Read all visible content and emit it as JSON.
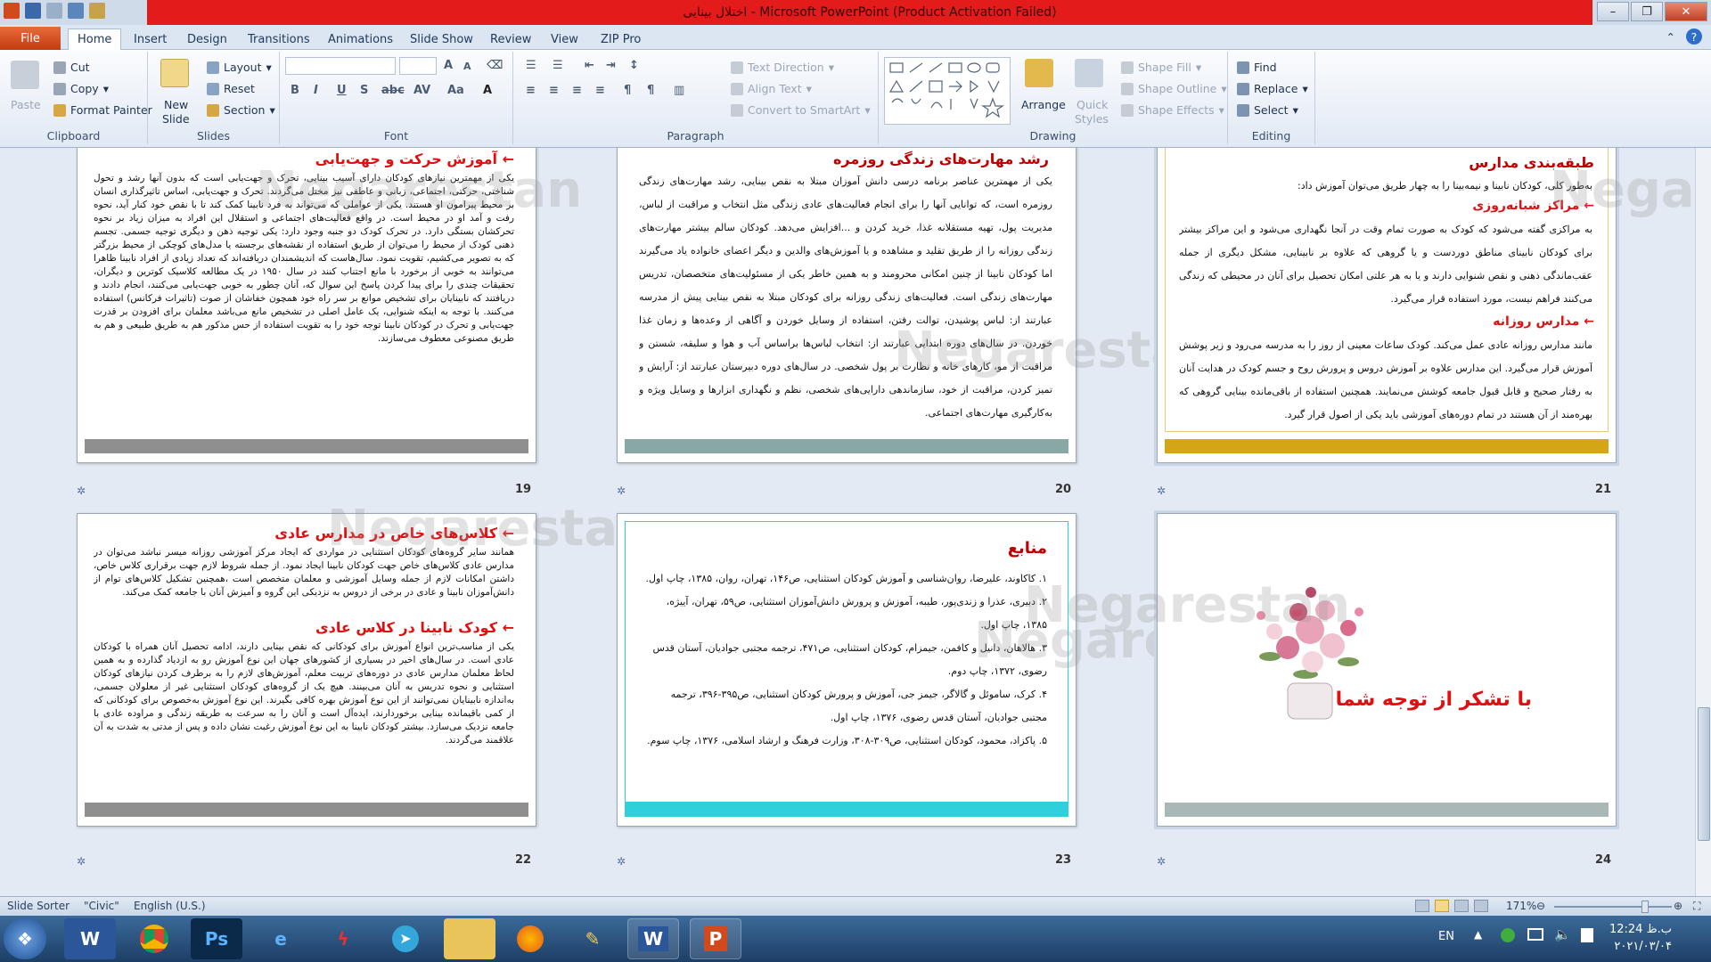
{
  "window": {
    "title": "اختلال بینایی  - Microsoft PowerPoint (Product Activation Failed)",
    "minimize_icon": "minimize-icon",
    "maximize_icon": "restore-icon",
    "close_icon": "close-icon"
  },
  "tabs": [
    "File",
    "Home",
    "Insert",
    "Design",
    "Transitions",
    "Animations",
    "Slide Show",
    "Review",
    "View",
    "ZIP Pro"
  ],
  "ribbon": {
    "clipboard": {
      "label": "Clipboard",
      "paste": "Paste",
      "cut": "Cut",
      "copy": "Copy",
      "format_painter": "Format Painter"
    },
    "slides": {
      "label": "Slides",
      "new_slide": "New",
      "new_slide2": "Slide",
      "layout": "Layout",
      "reset": "Reset",
      "section": "Section"
    },
    "font": {
      "label": "Font"
    },
    "paragraph": {
      "label": "Paragraph",
      "text_direction": "Text Direction",
      "align_text": "Align Text",
      "convert": "Convert to SmartArt"
    },
    "drawing": {
      "label": "Drawing",
      "arrange": "Arrange",
      "quick_styles": "Quick",
      "quick_styles2": "Styles",
      "shape_fill": "Shape Fill",
      "shape_outline": "Shape Outline",
      "shape_effects": "Shape Effects"
    },
    "editing": {
      "label": "Editing",
      "find": "Find",
      "replace": "Replace",
      "select": "Select"
    }
  },
  "watermark": "Negarestan",
  "slides": [
    {
      "number": "19",
      "title": "آموزش حرکت و جهت‌یابی",
      "body": "یکی از مهمترین نیازهای کودکان دارای آسیب بینایی، تحرک و جهت‌یابی است که بدون آنها رشد و تحول شناختی، حرکتی، اجتماعی، زبانی و عاطفی نیز مختل می‌گردند. تحرک و جهت‌یابی، اساس تاثیرگذاری انسان بر محیط پیرامون او هستند. یکی از عواملی که می‌تواند به فرد نابینا کمک کند تا با نقص خود کنار آید، نحوه رفت و آمد او در محیط است. در واقع فعالیت‌های اجتماعی و استقلال این افراد به میزان زیاد بر نحوه تحرکشان بستگی دارد. در تحرک کودک دو جنبه وجود دارد: یکی توجیه ذهن و دیگری توجیه جسمی. تجسم ذهنی کودک از محیط را می‌توان از طریق استفاده از نقشه‌های برجسته یا مدل‌های کوچکی از محیط بزرگتر که به تصویر می‌کشیم، تقویت نمود. سال‌هاست که اندیشمندان دریافته‌اند که تعداد زیادی از افراد نابینا ظاهرا می‌توانند به خوبی از برخورد با مانع اجتناب کنند در سال ۱۹۵۰ در یک مطالعه کلاسیک کوترین و دیگران، تحقیقات چندی را برای پیدا کردن پاسخ این سوال که، آنان چطور به خوبی جهت‌یابی می‌کنند، انجام دادند و دریافتند که نابینایان برای تشخیص موانع بر سر راه خود همچون خفاشان از صوت (تاثیرات فرکانس) استفاده می‌کنند. با توجه به اینکه شنوایی، یک عامل اصلی در تشخیص مانع می‌باشد معلمان برای افزودن بر قدرت جهت‌یابی و تحرک در کودکان نابینا توجه خود را به تقویت استفاده از حس مذکور هم به طریق طبیعی و هم به طریق مصنوعی معطوف می‌سازند."
    },
    {
      "number": "20",
      "title": "رشد مهارت‌های زندگی روزمره",
      "body": "یکی از مهمترین عناصر برنامه درسی دانش آموزان مبتلا به نقص بینایی، رشد مهارت‌های زندگی روزمره است، که توانایی آنها را برای انجام فعالیت‌های عادی زندگی مثل انتخاب و مراقبت از لباس، مدیریت پول، تهیه مستقلانه غذا، خرید کردن و ...افزایش می‌دهد. کودکان سالم بیشتر مهارت‌های زندگی روزانه را از طریق تقلید و مشاهده و یا آموزش‌های والدین و دیگر اعضای خانواده یاد می‌گیرند اما کودکان نابینا از چنین امکانی محرومند و به همین خاطر یکی از مسئولیت‌های متخصصان، تدریس مهارت‌های زندگی است. فعالیت‌های زندگی روزانه برای کودکان مبتلا به نقص بینایی پیش از مدرسه عبارتند از: لباس پوشیدن، توالت رفتن، استفاده از وسایل خوردن و آگاهی از وعده‌ها و زمان غذا خوردن. در سال‌های دوره ابتدایی عبارتند از: انتخاب لباس‌ها براساس آب و هوا و سلیقه، شستن و مراقبت از مو، کارهای خانه و نظارت بر پول شخصی. در سال‌های دوره دبیرستان عبارتند از: آرایش و تمیز کردن، مراقبت از خود، سازماندهی دارایی‌های شخصی، نظم و نگهداری ابزارها و وسایل ویژه و به‌کارگیری مهارت‌های اجتماعی."
    },
    {
      "number": "21",
      "title": "طبقه‌بندی مدارس",
      "intro": "به‌طور کلی، کودکان نابینا و نیمه‌بینا را به چهار طریق می‌توان آموزش داد:",
      "sub1": "مراکز شبانه‌روزی",
      "body1": "به مراکزی گفته می‌شود که کودک به صورت تمام وقت در آنجا نگهداری می‌شود و این مراکز بیشتر برای کودکان نابینای مناطق دوردست و یا گروهی که علاوه بر نابینایی، مشکل دیگری از جمله عقب‌ماندگی ذهنی و نقص شنوایی دارند و یا به هر علتی امکان تحصیل برای آنان در محیطی که زندگی می‌کنند فراهم نیست، مورد استفاده قرار می‌گیرد.",
      "sub2": "مدارس روزانه",
      "body2": "مانند مدارس روزانه عادی عمل می‌کند. کودک ساعات معینی از روز را به مدرسه می‌رود و زیر پوشش آموزش قرار می‌گیرد. این مدارس علاوه بر آموزش دروس و پرورش روح و جسم کودک در هدایت آنان به رفتار صحیح و قابل قبول جامعه کوشش می‌نمایند. همچنین استفاده از باقی‌مانده بینایی گروهی که بهره‌مند از آن هستند در تمام دوره‌های آموزشی باید یکی از اصول قرار گیرد."
    },
    {
      "number": "22",
      "title": "کلاس‌های خاص در مدارس عادی",
      "body1": "همانند سایر گروه‌های کودکان استثنایی در مواردی که ایجاد مرکز آموزشی روزانه میسر نباشد می‌توان در مدارس عادی کلاس‌های خاص جهت کودکان نابینا ایجاد نمود. از جمله شروط لازم جهت برقراری کلاس خاص، داشتن امکانات لازم از جمله وسایل آموزشی و معلمان متخصص است ،همچنین تشکیل کلاس‌های توام از دانش‌آموزان نابینا و عادی در برخی از دروس به نزدیکی این گروه و آمیزش آنان با جامعه کمک می‌کند.",
      "title2": "کودک نابینا در کلاس عادی",
      "body2": "یکی از مناسب‌ترین انواع آموزش برای کودکانی که نقص بینایی دارند، ادامه تحصیل آنان همراه با کودکان عادی است. در سال‌های اخیر در بسیاری از کشورهای جهان این نوع آموزش رو به ازدیاد گذارده و به همین لحاظ معلمان مدارس عادی در دوره‌های تربیت معلم، آموزش‌های لازم را به برطرف کردن نیازهای کودکان استثنایی و نحوه تدریس به آنان می‌بینند. هیچ یک از گروه‌های کودکان استثنایی غیر از معلولان جسمی، به‌اندازه نابینایان نمی‌توانند از این نوع آموزش بهره کافی بگیرند. این نوع آموزش به‌خصوص برای کودکانی که از کمی باقیمانده بینایی برخوردارند، ایده‌آل است و آنان را به سرعت به طریقه زندگی و مراوده عادی با جامعه نزدیک می‌سازد. بیشتر کودکان نابینا به این نوع آموزش رغبت نشان داده و پس از مدتی به شدت به آن علاقمند می‌گردند."
    },
    {
      "number": "23",
      "title": "منابع",
      "refs": [
        "۱.  کاکاوند، علیرضا، روان‌شناسی و آموزش کودکان استثنایی، ص۱۴۶، تهران، روان، ۱۳۸۵، چاپ اول.",
        "۲.  دبیری، عذرا و زندی‌پور، طیبه، آموزش و پرورش دانش‌آموزان استثنایی، ص۵۹، تهران، آییژه، ۱۳۸۵، چاپ اول.",
        "۳.  هالاهان، دانیل و کافمن، جیمزام، کودکان استثنایی، ص۴۷۱، ترجمه مجتبی جوادیان، آستان قدس رضوی، ۱۳۷۲، چاپ دوم.",
        "۴.  کرک، ساموئل و گالاگر، جیمز جی، آموزش و پرورش کودکان استثنایی، ص۳۹۵-۳۹۶، ترجمه مجتبی جوادیان، آستان قدس رضوی، ۱۳۷۶، چاپ اول.",
        "۵.  پاکزاد، محمود، کودکان استثنایی، ص۳۰۹-۳۰۸، وزارت فرهنگ و ارشاد اسلامی، ۱۳۷۶، چاپ سوم."
      ]
    },
    {
      "number": "24",
      "title": "با تشکر از توجه شما"
    }
  ],
  "status": {
    "view": "Slide Sorter",
    "theme": "\"Civic\"",
    "language": "English (U.S.)",
    "zoom": "171%"
  },
  "tray": {
    "lang": "EN",
    "time": "12:24 ب.ظ",
    "date": "۲۰۲۱/۰۳/۰۴"
  },
  "colors": {
    "accent_red": "#e01010",
    "bar19": "#8f8f8f",
    "bar20": "#88a8a6",
    "bar21": "#d4a514",
    "bar22": "#8f8f8f",
    "bar23": "#2fd0dc",
    "bar24": "#a9b8b6"
  }
}
